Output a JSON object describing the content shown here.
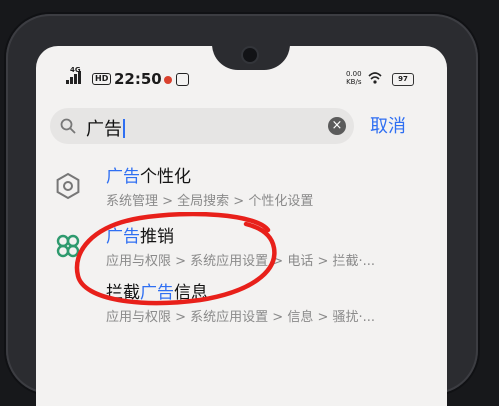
{
  "status_bar": {
    "network": "4G",
    "hd": "HD",
    "time": "22:50",
    "speed_value": "0.00",
    "speed_unit": "KB/s",
    "battery": "97"
  },
  "search": {
    "query": "广告",
    "clear_icon": "clear-icon",
    "cancel_label": "取消"
  },
  "results": [
    {
      "icon": "hexagon-settings-icon",
      "title_highlight": "广告",
      "title_rest": "个性化",
      "path": "系统管理 > 全局搜索 > 个性化设置"
    },
    {
      "icon": "clover-app-icon",
      "title_highlight": "广告",
      "title_rest": "推销",
      "path": "应用与权限 > 系统应用设置 > 电话 > 拦截·..."
    },
    {
      "icon": "none",
      "title_prefix": "拦截",
      "title_highlight": "广告",
      "title_rest": "信息",
      "path": "应用与权限 > 系统应用设置 > 信息 > 骚扰·..."
    }
  ],
  "colors": {
    "accent": "#2f6ff2",
    "annotation": "#e8201a"
  }
}
